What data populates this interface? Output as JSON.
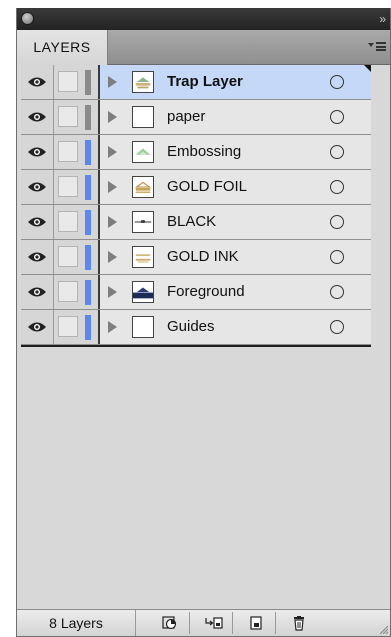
{
  "panel": {
    "tab_label": "LAYERS",
    "footer": {
      "layer_count": "8 Layers",
      "buttons": [
        {
          "name": "make-clipping-mask-button",
          "icon": "clipping-mask-icon"
        },
        {
          "name": "create-sublayer-button",
          "icon": "new-sublayer-icon"
        },
        {
          "name": "create-new-layer-button",
          "icon": "new-layer-icon"
        },
        {
          "name": "delete-layer-button",
          "icon": "trash-icon"
        }
      ]
    }
  },
  "layers": [
    {
      "name": "Trap Layer",
      "selected": true,
      "color": "#8a8a8a",
      "thumb": "trap"
    },
    {
      "name": "paper",
      "selected": false,
      "color": "#8a8a8a",
      "thumb": "blank"
    },
    {
      "name": "Embossing",
      "selected": false,
      "color": "#5b86f5",
      "thumb": "emboss"
    },
    {
      "name": "GOLD FOIL",
      "selected": false,
      "color": "#5b86f5",
      "thumb": "foil"
    },
    {
      "name": "BLACK",
      "selected": false,
      "color": "#5b86f5",
      "thumb": "black"
    },
    {
      "name": "GOLD INK",
      "selected": false,
      "color": "#5b86f5",
      "thumb": "ink"
    },
    {
      "name": "Foreground",
      "selected": false,
      "color": "#5b86f5",
      "thumb": "foreground"
    },
    {
      "name": "Guides",
      "selected": false,
      "color": "#5b86f5",
      "thumb": "blank"
    }
  ]
}
